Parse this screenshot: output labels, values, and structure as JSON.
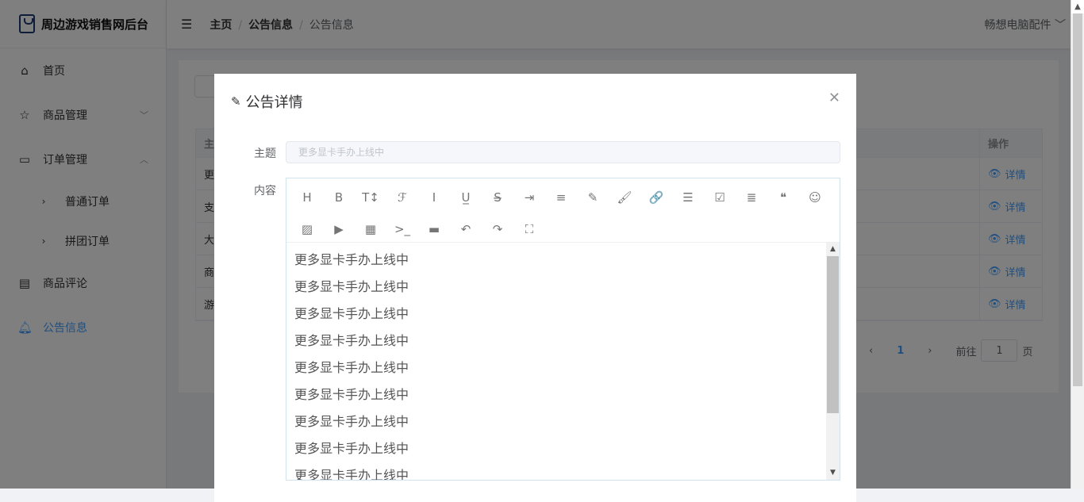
{
  "app_title": "周边游戏销售网后台",
  "sidebar": {
    "items": [
      {
        "label": "首页",
        "icon": "home-icon"
      },
      {
        "label": "商品管理",
        "icon": "star-icon"
      },
      {
        "label": "订单管理",
        "icon": "board-icon"
      },
      {
        "label": "普通订单"
      },
      {
        "label": "拼团订单"
      },
      {
        "label": "商品评论",
        "icon": "comment-icon"
      },
      {
        "label": "公告信息",
        "icon": "bell-icon"
      }
    ]
  },
  "header": {
    "breadcrumb": [
      "主页",
      "公告信息",
      "公告信息"
    ],
    "separator": "/",
    "user": "畅想电脑配件"
  },
  "table": {
    "headers": [
      "主",
      "操作"
    ],
    "rows": [
      {
        "title": "更",
        "action": "详情"
      },
      {
        "title": "支",
        "action": "详情"
      },
      {
        "title": "大",
        "action": "详情"
      },
      {
        "title": "商",
        "action": "详情"
      },
      {
        "title": "游",
        "action": "详情"
      }
    ]
  },
  "pagination": {
    "current": "1",
    "goto_label": "前往",
    "goto_value": "1",
    "page_suffix": "页"
  },
  "modal": {
    "title": "公告详情",
    "subject_label": "主题",
    "subject_value": "更多显卡手办上线中",
    "content_label": "内容",
    "content_lines": [
      "更多显卡手办上线中",
      "更多显卡手办上线中",
      "更多显卡手办上线中",
      "更多显卡手办上线中",
      "更多显卡手办上线中",
      "更多显卡手办上线中",
      "更多显卡手办上线中",
      "更多显卡手办上线中",
      "更多显卡手办上线中"
    ]
  },
  "toolbar": [
    {
      "name": "heading",
      "glyph": "H"
    },
    {
      "name": "bold",
      "glyph": "B"
    },
    {
      "name": "font-size",
      "glyph": "T↕"
    },
    {
      "name": "font-family",
      "glyph": "ℱ"
    },
    {
      "name": "italic",
      "glyph": "I"
    },
    {
      "name": "underline",
      "glyph": "U̲"
    },
    {
      "name": "strikethrough",
      "glyph": "S̶"
    },
    {
      "name": "indent",
      "glyph": "⇥"
    },
    {
      "name": "line-height",
      "glyph": "≡"
    },
    {
      "name": "fore-color",
      "glyph": "✎"
    },
    {
      "name": "back-color",
      "glyph": "🖌"
    },
    {
      "name": "link",
      "glyph": "🔗"
    },
    {
      "name": "list",
      "glyph": "☰"
    },
    {
      "name": "todo",
      "glyph": "☑"
    },
    {
      "name": "justify",
      "glyph": "≣"
    },
    {
      "name": "quote",
      "glyph": "❝"
    },
    {
      "name": "emoticon",
      "glyph": "☺"
    },
    {
      "name": "image",
      "glyph": "▨"
    },
    {
      "name": "video",
      "glyph": "▶"
    },
    {
      "name": "table",
      "glyph": "▦"
    },
    {
      "name": "code",
      "glyph": ">_"
    },
    {
      "name": "divider",
      "glyph": "▬"
    },
    {
      "name": "undo",
      "glyph": "↶"
    },
    {
      "name": "redo",
      "glyph": "↷"
    },
    {
      "name": "fullscreen",
      "glyph": "⛶"
    }
  ]
}
